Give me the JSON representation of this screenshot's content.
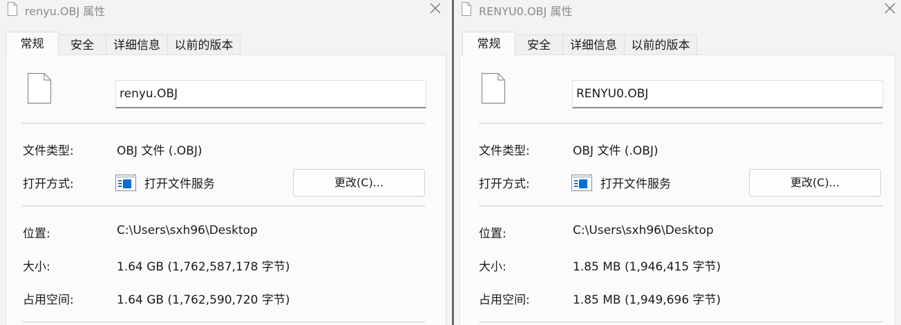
{
  "left_dialog": {
    "title": "renyu.OBJ 属性",
    "tabs": [
      "常规",
      "安全",
      "详细信息",
      "以前的版本"
    ],
    "active_tab": "常规",
    "filename": "renyu.OBJ",
    "labels": {
      "type": "文件类型:",
      "opens_with": "打开方式:",
      "location": "位置:",
      "size": "大小:",
      "size_on_disk": "占用空间:"
    },
    "file_type": "OBJ 文件 (.OBJ)",
    "opens_with_app": "打开文件服务",
    "change_button": "更改(C)...",
    "location": "C:\\Users\\sxh96\\Desktop",
    "size": "1.64 GB (1,762,587,178 字节)",
    "size_on_disk": "1.64 GB (1,762,590,720 字节)",
    "icons": {
      "title": "document-icon",
      "close": "close-icon",
      "file": "document-icon",
      "app": "open-file-service-icon"
    }
  },
  "right_dialog": {
    "title": "RENYU0.OBJ 属性",
    "tabs": [
      "常规",
      "安全",
      "详细信息",
      "以前的版本"
    ],
    "active_tab": "常规",
    "filename": "RENYU0.OBJ",
    "labels": {
      "type": "文件类型:",
      "opens_with": "打开方式:",
      "location": "位置:",
      "size": "大小:",
      "size_on_disk": "占用空间:"
    },
    "file_type": "OBJ 文件 (.OBJ)",
    "opens_with_app": "打开文件服务",
    "change_button": "更改(C)...",
    "location": "C:\\Users\\sxh96\\Desktop",
    "size": "1.85 MB (1,946,415 字节)",
    "size_on_disk": "1.85 MB (1,949,696 字节)",
    "icons": {
      "title": "document-icon",
      "close": "close-icon",
      "file": "document-icon",
      "app": "open-file-service-icon"
    }
  },
  "colors": {
    "accent_blue": "#0a6fd1",
    "title_gray": "#8a8a8a",
    "window_bg": "#f3f3f3",
    "panel_bg": "#fbfbfb"
  }
}
